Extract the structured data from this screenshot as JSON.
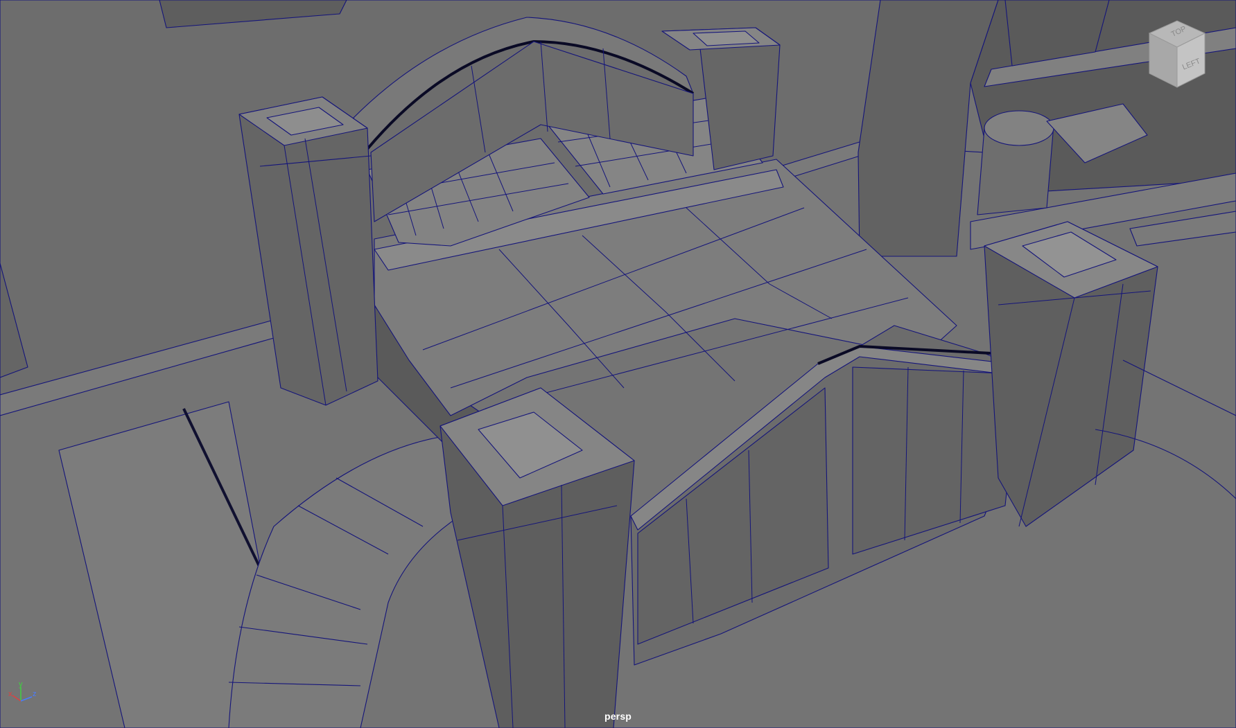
{
  "viewport": {
    "camera": "persp",
    "background_color": "#737373",
    "wire_color": "#14147a"
  },
  "view_cube": {
    "front_face": "LEFT",
    "top_face": "TOP"
  },
  "axis_gizmo": {
    "x": "x",
    "y": "y",
    "z": "z",
    "x_color": "#e04040",
    "y_color": "#40d040",
    "z_color": "#4a7cff"
  }
}
